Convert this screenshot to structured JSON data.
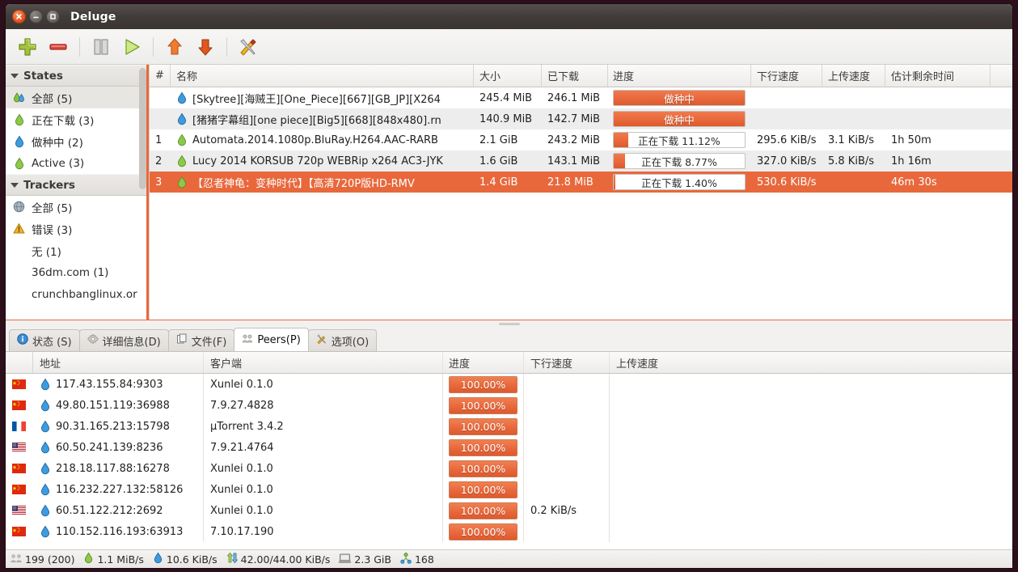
{
  "window": {
    "title": "Deluge"
  },
  "toolbar": {
    "buttons": [
      {
        "name": "add-torrent-button",
        "icon": "plus-icon",
        "label": "Add Torrent"
      },
      {
        "name": "remove-torrent-button",
        "icon": "minus-icon",
        "label": "Remove Torrent"
      },
      {
        "name": "pause-button",
        "icon": "pause-icon",
        "label": "Pause"
      },
      {
        "name": "resume-button",
        "icon": "play-icon",
        "label": "Resume"
      },
      {
        "name": "queue-up-button",
        "icon": "arrow-up-icon",
        "label": "Queue Up"
      },
      {
        "name": "queue-down-button",
        "icon": "arrow-down-icon",
        "label": "Queue Down"
      },
      {
        "name": "preferences-button",
        "icon": "tools-icon",
        "label": "Preferences"
      }
    ]
  },
  "sidebar": {
    "groups": [
      {
        "label": "States",
        "items": [
          {
            "label": "全部 (5)",
            "icon": "multi-drop-icon",
            "selected": true
          },
          {
            "label": "正在下载 (3)",
            "icon": "green-drop-icon",
            "selected": false
          },
          {
            "label": "做种中 (2)",
            "icon": "blue-drop-icon",
            "selected": false
          },
          {
            "label": "Active (3)",
            "icon": "green-drop-icon",
            "selected": false
          }
        ]
      },
      {
        "label": "Trackers",
        "items": [
          {
            "label": "全部 (5)",
            "icon": "globe-icon",
            "selected": false
          },
          {
            "label": "错误 (3)",
            "icon": "warning-icon",
            "selected": false
          },
          {
            "label": "无 (1)",
            "icon": "none-icon",
            "selected": false
          },
          {
            "label": "36dm.com (1)",
            "icon": "none-icon",
            "selected": false
          },
          {
            "label": "crunchbanglinux.or",
            "icon": "none-icon",
            "selected": false
          }
        ]
      }
    ]
  },
  "torrent_table": {
    "columns": [
      "#",
      "名称",
      "大小",
      "已下载",
      "进度",
      "下行速度",
      "上传速度",
      "估计剩余时间"
    ],
    "rows": [
      {
        "num": "",
        "icon": "blue-drop-icon",
        "name": "[Skytree][海贼王][One_Piece][667][GB_JP][X264",
        "size": "245.4 MiB",
        "downloaded": "246.1 MiB",
        "progress_label": "做种中",
        "progress_pct": 100,
        "download_speed": "",
        "upload_speed": "",
        "eta": "",
        "selected": false,
        "alt": false
      },
      {
        "num": "",
        "icon": "blue-drop-icon",
        "name": "[猪猪字幕组][one piece][Big5][668][848x480].rn",
        "size": "140.9 MiB",
        "downloaded": "142.7 MiB",
        "progress_label": "做种中",
        "progress_pct": 100,
        "download_speed": "",
        "upload_speed": "",
        "eta": "",
        "selected": false,
        "alt": true
      },
      {
        "num": "1",
        "icon": "green-drop-icon",
        "name": "Automata.2014.1080p.BluRay.H264.AAC-RARB",
        "size": "2.1 GiB",
        "downloaded": "243.2 MiB",
        "progress_label": "正在下载 11.12%",
        "progress_pct": 11.12,
        "download_speed": "295.6 KiB/s",
        "upload_speed": "3.1 KiB/s",
        "eta": "1h 50m",
        "selected": false,
        "alt": false
      },
      {
        "num": "2",
        "icon": "green-drop-icon",
        "name": "Lucy 2014 KORSUB 720p WEBRip x264 AC3-JYK",
        "size": "1.6 GiB",
        "downloaded": "143.1 MiB",
        "progress_label": "正在下载 8.77%",
        "progress_pct": 8.77,
        "download_speed": "327.0 KiB/s",
        "upload_speed": "5.8 KiB/s",
        "eta": "1h 16m",
        "selected": false,
        "alt": true
      },
      {
        "num": "3",
        "icon": "green-drop-icon",
        "name": "【忍者神龟：变种时代】【高清720P版HD-RMV",
        "size": "1.4 GiB",
        "downloaded": "21.8 MiB",
        "progress_label": "正在下载 1.40%",
        "progress_pct": 1.4,
        "download_speed": "530.6 KiB/s",
        "upload_speed": "",
        "eta": "46m 30s",
        "selected": true,
        "alt": false
      }
    ]
  },
  "tabs": [
    {
      "label": "状态 (S)",
      "icon": "info-icon",
      "active": false
    },
    {
      "label": "详细信息(D)",
      "icon": "gear-icon",
      "active": false
    },
    {
      "label": "文件(F)",
      "icon": "files-icon",
      "active": false
    },
    {
      "label": "Peers(P)",
      "icon": "peers-icon",
      "active": true
    },
    {
      "label": "选项(O)",
      "icon": "tools-icon",
      "active": false
    }
  ],
  "peers_table": {
    "columns": [
      "",
      "地址",
      "客户端",
      "进度",
      "下行速度",
      "上传速度"
    ],
    "rows": [
      {
        "flag": "cn",
        "address": "117.43.155.84:9303",
        "client": "Xunlei 0.1.0",
        "progress_label": "100.00%",
        "progress_pct": 100,
        "download_speed": "",
        "upload_speed": ""
      },
      {
        "flag": "cn",
        "address": "49.80.151.119:36988",
        "client": "7.9.27.4828",
        "progress_label": "100.00%",
        "progress_pct": 100,
        "download_speed": "",
        "upload_speed": ""
      },
      {
        "flag": "fr",
        "address": "90.31.165.213:15798",
        "client": "µTorrent 3.4.2",
        "progress_label": "100.00%",
        "progress_pct": 100,
        "download_speed": "",
        "upload_speed": ""
      },
      {
        "flag": "us",
        "address": "60.50.241.139:8236",
        "client": "7.9.21.4764",
        "progress_label": "100.00%",
        "progress_pct": 100,
        "download_speed": "",
        "upload_speed": ""
      },
      {
        "flag": "cn",
        "address": "218.18.117.88:16278",
        "client": "Xunlei 0.1.0",
        "progress_label": "100.00%",
        "progress_pct": 100,
        "download_speed": "",
        "upload_speed": ""
      },
      {
        "flag": "cn",
        "address": "116.232.227.132:58126",
        "client": "Xunlei 0.1.0",
        "progress_label": "100.00%",
        "progress_pct": 100,
        "download_speed": "",
        "upload_speed": ""
      },
      {
        "flag": "us",
        "address": "60.51.122.212:2692",
        "client": "Xunlei 0.1.0",
        "progress_label": "100.00%",
        "progress_pct": 100,
        "download_speed": "0.2 KiB/s",
        "upload_speed": ""
      },
      {
        "flag": "cn",
        "address": "110.152.116.193:63913",
        "client": "7.10.17.190",
        "progress_label": "100.00%",
        "progress_pct": 100,
        "download_speed": "",
        "upload_speed": ""
      }
    ]
  },
  "statusbar": {
    "connections": "199 (200)",
    "download_speed": "1.1 MiB/s",
    "upload_speed": "10.6 KiB/s",
    "protocol_traffic": "42.00/44.00 KiB/s",
    "free_space": "2.3 GiB",
    "dht_nodes": "168"
  },
  "colors": {
    "accent_orange": "#e8683c",
    "selection": "#e8683c",
    "titlebar": "#413c39",
    "window_bg": "#f2f1f0"
  }
}
